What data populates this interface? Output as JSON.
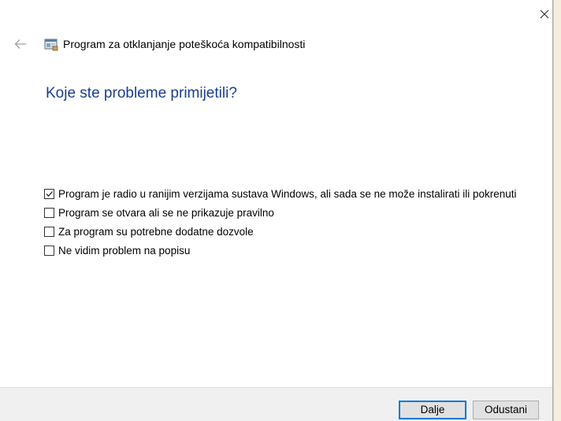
{
  "window": {
    "title": "Program za otklanjanje poteškoća kompatibilnosti"
  },
  "page": {
    "heading": "Koje ste probleme primijetili?"
  },
  "options": [
    {
      "label": "Program je radio u ranijim verzijama sustava Windows, ali sada se ne može instalirati ili pokrenuti",
      "checked": true
    },
    {
      "label": "Program se otvara ali se ne prikazuje pravilno",
      "checked": false
    },
    {
      "label": "Za program su potrebne dodatne dozvole",
      "checked": false
    },
    {
      "label": "Ne vidim problem na popisu",
      "checked": false
    }
  ],
  "buttons": {
    "next": "Dalje",
    "cancel": "Odustani"
  },
  "icons": {
    "close": "close-icon",
    "back": "back-arrow-icon",
    "app": "compatibility-troubleshooter-icon",
    "check": "checkmark-icon"
  },
  "colors": {
    "heading": "#1a3e8c",
    "accent": "#0078d7",
    "footer": "#f0f0f0"
  }
}
